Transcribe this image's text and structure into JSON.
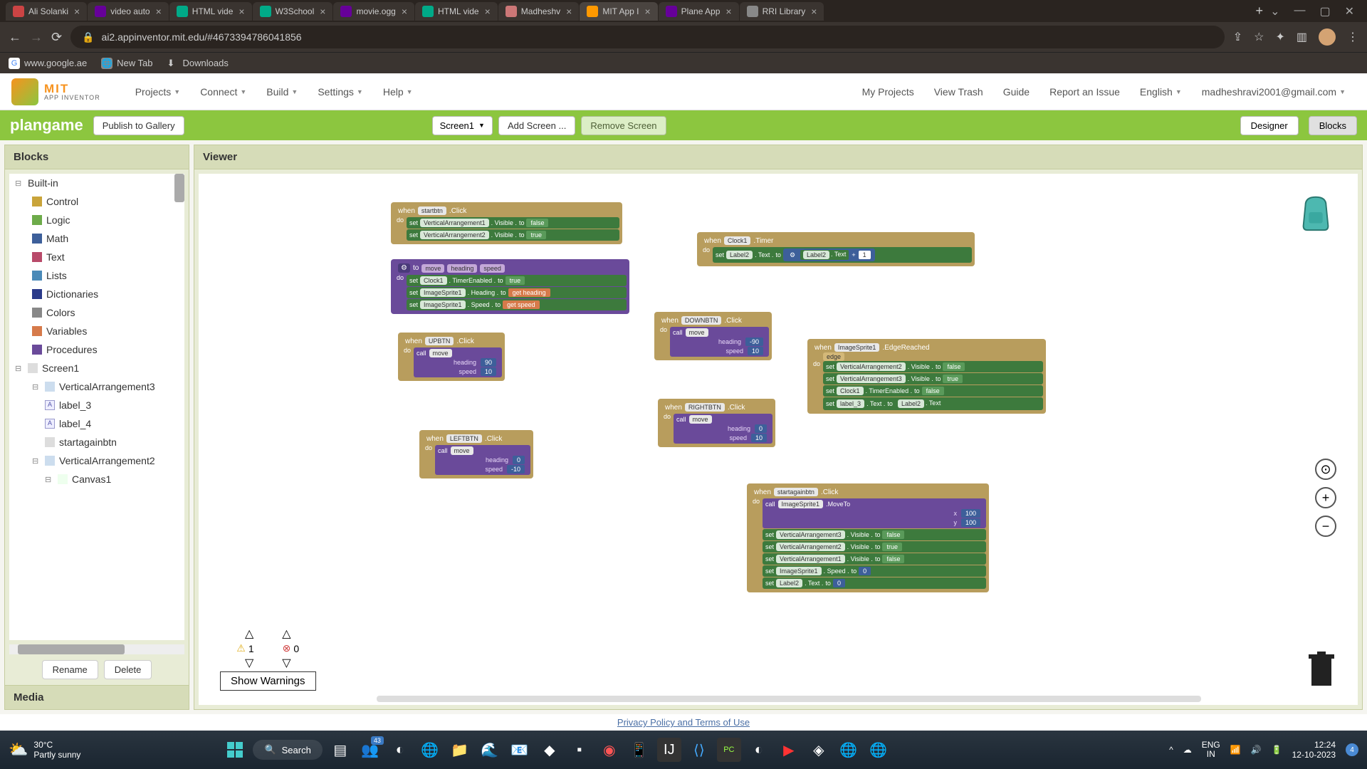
{
  "browser": {
    "tabs": [
      {
        "title": "Ali Solanki",
        "icon": "#c44"
      },
      {
        "title": "video auto",
        "icon": "#609"
      },
      {
        "title": "HTML vide",
        "icon": "#0a8"
      },
      {
        "title": "W3School",
        "icon": "#0a8"
      },
      {
        "title": "movie.ogg",
        "icon": "#609"
      },
      {
        "title": "HTML vide",
        "icon": "#0a8"
      },
      {
        "title": "Madheshv",
        "icon": "#c77"
      },
      {
        "title": "MIT App I",
        "icon": "#f90",
        "active": true
      },
      {
        "title": "Plane App",
        "icon": "#609"
      },
      {
        "title": "RRI Library",
        "icon": "#888"
      }
    ],
    "url": "ai2.appinventor.mit.edu/#4673394786041856",
    "bookmarks": [
      {
        "label": "www.google.ae"
      },
      {
        "label": "New Tab"
      },
      {
        "label": "Downloads"
      }
    ]
  },
  "topnav": {
    "logo_mit": "MIT",
    "logo_sub": "APP INVENTOR",
    "menu": [
      "Projects",
      "Connect",
      "Build",
      "Settings",
      "Help"
    ],
    "right": [
      "My Projects",
      "View Trash",
      "Guide",
      "Report an Issue"
    ],
    "lang": "English",
    "user": "madheshravi2001@gmail.com"
  },
  "projectbar": {
    "name": "plangame",
    "publish": "Publish to Gallery",
    "screen": "Screen1",
    "add": "Add Screen ...",
    "remove": "Remove Screen",
    "designer": "Designer",
    "blocks": "Blocks"
  },
  "sidebar": {
    "title": "Blocks",
    "builtin_label": "Built-in",
    "builtin": [
      {
        "name": "Control",
        "color": "#c9a43a"
      },
      {
        "name": "Logic",
        "color": "#6dab4a"
      },
      {
        "name": "Math",
        "color": "#3d5f9a"
      },
      {
        "name": "Text",
        "color": "#b84a6a"
      },
      {
        "name": "Lists",
        "color": "#4a8ab8"
      },
      {
        "name": "Dictionaries",
        "color": "#2a3a8a"
      },
      {
        "name": "Colors",
        "color": "#888"
      },
      {
        "name": "Variables",
        "color": "#d67a4a"
      },
      {
        "name": "Procedures",
        "color": "#6a4a9a"
      }
    ],
    "screen1": "Screen1",
    "tree": {
      "va3": "VerticalArrangement3",
      "l3": "label_3",
      "l4": "label_4",
      "startagain": "startagainbtn",
      "va2": "VerticalArrangement2",
      "canvas": "Canvas1"
    },
    "rename": "Rename",
    "delete": "Delete",
    "media": "Media"
  },
  "viewer": {
    "title": "Viewer",
    "warnings": {
      "warn_count": "1",
      "err_count": "0",
      "btn": "Show Warnings"
    }
  },
  "blocks": {
    "startbtn": {
      "when": "when",
      "comp": "startbtn",
      "evt": ".Click",
      "r1": {
        "set": "set",
        "c": "VerticalArrangement1",
        "p": ". Visible .",
        "to": "to",
        "v": "false"
      },
      "r2": {
        "set": "set",
        "c": "VerticalArrangement2",
        "p": ". Visible .",
        "to": "to",
        "v": "true"
      }
    },
    "move": {
      "to": "to",
      "name": "move",
      "a1": "heading",
      "a2": "speed",
      "r1": {
        "set": "set",
        "c": "Clock1",
        "p": ". TimerEnabled .",
        "to": "to",
        "v": "true"
      },
      "r2": {
        "set": "set",
        "c": "ImageSprite1",
        "p": ". Heading .",
        "to": "to",
        "g": "get",
        "v": "heading"
      },
      "r3": {
        "set": "set",
        "c": "ImageSprite1",
        "p": ". Speed .",
        "to": "to",
        "g": "get",
        "v": "speed"
      }
    },
    "upbtn": {
      "when": "when",
      "comp": "UPBTN",
      "evt": ".Click",
      "call": "call",
      "name": "move",
      "s1": {
        "l": "heading",
        "v": "90"
      },
      "s2": {
        "l": "speed",
        "v": "10"
      }
    },
    "leftbtn": {
      "when": "when",
      "comp": "LEFTBTN",
      "evt": ".Click",
      "call": "call",
      "name": "move",
      "s1": {
        "l": "heading",
        "v": "0"
      },
      "s2": {
        "l": "speed",
        "v": "-10"
      }
    },
    "downbtn": {
      "when": "when",
      "comp": "DOWNBTN",
      "evt": ".Click",
      "call": "call",
      "name": "move",
      "s1": {
        "l": "heading",
        "v": "-90"
      },
      "s2": {
        "l": "speed",
        "v": "10"
      }
    },
    "rightbtn": {
      "when": "when",
      "comp": "RIGHTBTN",
      "evt": ".Click",
      "call": "call",
      "name": "move",
      "s1": {
        "l": "heading",
        "v": "0"
      },
      "s2": {
        "l": "speed",
        "v": "10"
      }
    },
    "clock": {
      "when": "when",
      "comp": "Clock1",
      "evt": ".Timer",
      "set": "set",
      "c": "Label2",
      "p": ". Text .",
      "to": "to",
      "src": "Label2",
      "srcp": ". Text",
      "plus": "+",
      "one": "1"
    },
    "edge": {
      "when": "when",
      "comp": "ImageSprite1",
      "evt": ".EdgeReached",
      "arg": "edge",
      "r1": {
        "set": "set",
        "c": "VerticalArrangement2",
        "p": ". Visible .",
        "to": "to",
        "v": "false"
      },
      "r2": {
        "set": "set",
        "c": "VerticalArrangement3",
        "p": ". Visible .",
        "to": "to",
        "v": "true"
      },
      "r3": {
        "set": "set",
        "c": "Clock1",
        "p": ". TimerEnabled .",
        "to": "to",
        "v": "false"
      },
      "r4": {
        "set": "set",
        "c": "label_3",
        "p": ". Text .",
        "to": "to",
        "src": "Label2",
        "srcp": ". Text"
      }
    },
    "startagain": {
      "when": "when",
      "comp": "startagainbtn",
      "evt": ".Click",
      "call": "call",
      "c": "ImageSprite1",
      "m": ".MoveTo",
      "x": {
        "l": "x",
        "v": "100"
      },
      "y": {
        "l": "y",
        "v": "100"
      },
      "r1": {
        "set": "set",
        "c": "VerticalArrangement3",
        "p": ". Visible .",
        "to": "to",
        "v": "false"
      },
      "r2": {
        "set": "set",
        "c": "VerticalArrangement2",
        "p": ". Visible .",
        "to": "to",
        "v": "true"
      },
      "r3": {
        "set": "set",
        "c": "VerticalArrangement1",
        "p": ". Visible .",
        "to": "to",
        "v": "false"
      },
      "r4": {
        "set": "set",
        "c": "ImageSprite1",
        "p": ". Speed .",
        "to": "to",
        "v": "0"
      },
      "r5": {
        "set": "set",
        "c": "Label2",
        "p": ". Text .",
        "to": "to",
        "v": "0"
      }
    },
    "do": "do"
  },
  "footer": {
    "text": "Privacy Policy and Terms of Use"
  },
  "taskbar": {
    "weather": {
      "temp": "30°C",
      "desc": "Partly sunny"
    },
    "search": "Search",
    "lang": {
      "l1": "ENG",
      "l2": "IN"
    },
    "clock": {
      "time": "12:24",
      "date": "12-10-2023"
    },
    "notif": "4",
    "teams_badge": "43"
  }
}
